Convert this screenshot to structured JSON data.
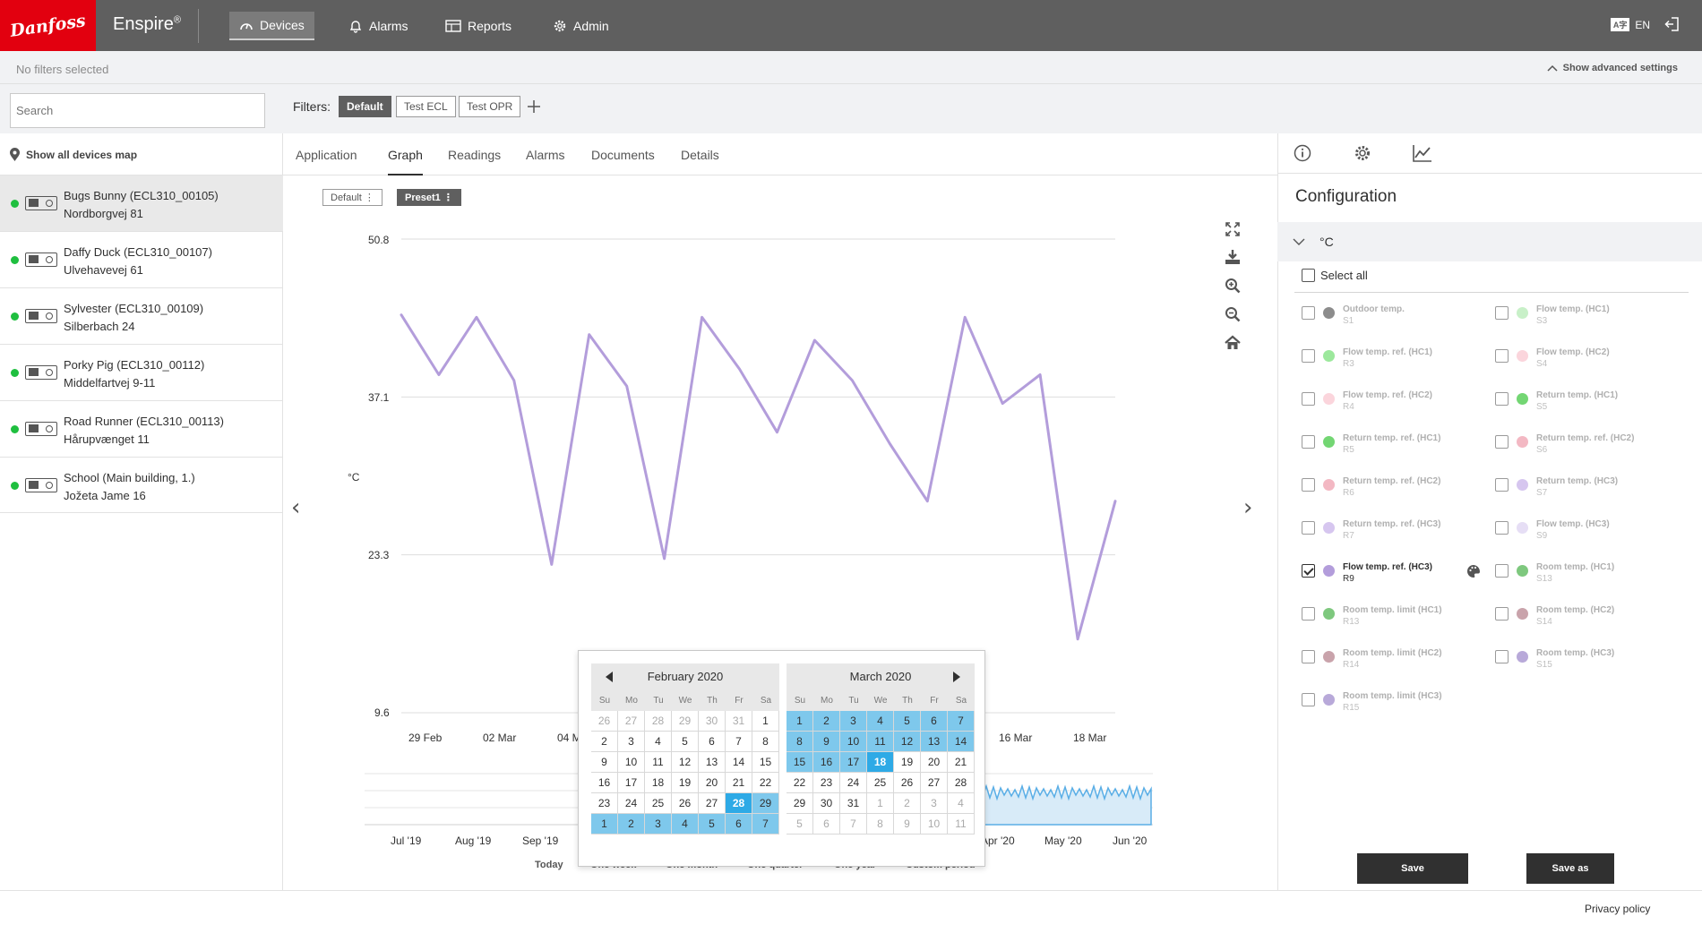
{
  "header": {
    "logo_text": "Danfoss",
    "brand": "Enspire",
    "brand_mark": "®",
    "nav": [
      {
        "label": "Devices",
        "icon": "gauge-icon",
        "active": true
      },
      {
        "label": "Alarms",
        "icon": "bell-icon"
      },
      {
        "label": "Reports",
        "icon": "table-icon"
      },
      {
        "label": "Admin",
        "icon": "gear-icon"
      }
    ],
    "language_badge": "A字",
    "language": "EN",
    "logout_icon": "logout-icon"
  },
  "filterbar": {
    "status": "No filters selected",
    "advanced_link": "Show advanced settings",
    "search_placeholder": "Search",
    "filters_label": "Filters:",
    "chips": [
      "Default",
      "Test ECL",
      "Test OPR"
    ],
    "add_icon": "plus-icon"
  },
  "sidebar": {
    "map_link": "Show all devices map",
    "devices": [
      {
        "name": "Bugs Bunny (ECL310_00105)",
        "address": "Nordborgvej 81",
        "online": true,
        "selected": true
      },
      {
        "name": "Daffy Duck (ECL310_00107)",
        "address": "Ulvehavevej 61",
        "online": true
      },
      {
        "name": "Sylvester (ECL310_00109)",
        "address": "Silberbach 24",
        "online": true
      },
      {
        "name": "Porky Pig (ECL310_00112)",
        "address": "Middelfartvej 9-11",
        "online": true
      },
      {
        "name": "Road Runner (ECL310_00113)",
        "address": "Hårupvænget 11",
        "online": true
      },
      {
        "name": "School (Main building, 1.)",
        "address": "Jožeta Jame 16",
        "online": true
      }
    ]
  },
  "main": {
    "tabs": [
      "Application",
      "Graph",
      "Readings",
      "Alarms",
      "Documents",
      "Details"
    ],
    "active_tab": "Graph",
    "presets": [
      "Default",
      "Preset1"
    ],
    "preset_menu_glyph": "⋮",
    "chart_tools": [
      "fullscreen-icon",
      "download-icon",
      "zoom-in-icon",
      "zoom-out-icon",
      "home-icon"
    ],
    "prev_arrow": "‹",
    "next_arrow": "›",
    "periods": [
      "Today",
      "One week",
      "One month",
      "One quarter",
      "One year",
      "Custom period"
    ]
  },
  "chart_data": {
    "type": "line",
    "title": "",
    "ylabel": "°C",
    "ylim": [
      9.6,
      50.8
    ],
    "yticks": [
      "50.8",
      "37.1",
      "23.3",
      "9.6"
    ],
    "xticks": [
      "29 Feb",
      "02 Mar",
      "04 M",
      "16 Mar",
      "18 Mar"
    ],
    "color": "#b39ddb",
    "x": [
      "2020-02-29",
      "2020-03-01",
      "2020-03-02",
      "2020-03-03",
      "2020-03-04",
      "2020-03-05",
      "2020-03-06",
      "2020-03-07",
      "2020-03-08",
      "2020-03-09",
      "2020-03-10",
      "2020-03-11",
      "2020-03-12",
      "2020-03-13",
      "2020-03-14",
      "2020-03-15",
      "2020-03-16",
      "2020-03-17",
      "2020-03-18",
      "2020-03-19"
    ],
    "series": [
      {
        "values": [
          44.2,
          39.0,
          44.0,
          38.5,
          22.5,
          42.5,
          38.0,
          23.0,
          44.0,
          39.5,
          34.0,
          42.0,
          38.5,
          33.0,
          28.0,
          44.0,
          36.5,
          39.0,
          16.0,
          28.0
        ]
      }
    ],
    "navigator": {
      "x_ticks": [
        "Jul '19",
        "Aug '19",
        "Sep '19",
        "Apr '20",
        "May '20",
        "Jun '20"
      ],
      "color": "#5aaee6"
    }
  },
  "calendar": {
    "weekdays": [
      "Su",
      "Mo",
      "Tu",
      "We",
      "Th",
      "Fr",
      "Sa"
    ],
    "months": [
      {
        "title": "February 2020",
        "days": [
          {
            "d": "26",
            "o": 1
          },
          {
            "d": "27",
            "o": 1
          },
          {
            "d": "28",
            "o": 1
          },
          {
            "d": "29",
            "o": 1
          },
          {
            "d": "30",
            "o": 1
          },
          {
            "d": "31",
            "o": 1
          },
          {
            "d": "1"
          },
          {
            "d": "2"
          },
          {
            "d": "3"
          },
          {
            "d": "4"
          },
          {
            "d": "5"
          },
          {
            "d": "6"
          },
          {
            "d": "7"
          },
          {
            "d": "8"
          },
          {
            "d": "9"
          },
          {
            "d": "10"
          },
          {
            "d": "11"
          },
          {
            "d": "12"
          },
          {
            "d": "13"
          },
          {
            "d": "14"
          },
          {
            "d": "15"
          },
          {
            "d": "16"
          },
          {
            "d": "17"
          },
          {
            "d": "18"
          },
          {
            "d": "19"
          },
          {
            "d": "20"
          },
          {
            "d": "21"
          },
          {
            "d": "22"
          },
          {
            "d": "23"
          },
          {
            "d": "24"
          },
          {
            "d": "25"
          },
          {
            "d": "26"
          },
          {
            "d": "27"
          },
          {
            "d": "28",
            "s": 1
          },
          {
            "d": "29",
            "r": 1
          },
          {
            "d": "1",
            "r": 1
          },
          {
            "d": "2",
            "r": 1
          },
          {
            "d": "3",
            "r": 1
          },
          {
            "d": "4",
            "r": 1
          },
          {
            "d": "5",
            "r": 1
          },
          {
            "d": "6",
            "r": 1
          },
          {
            "d": "7",
            "r": 1
          }
        ]
      },
      {
        "title": "March 2020",
        "days": [
          {
            "d": "1",
            "r": 1
          },
          {
            "d": "2",
            "r": 1
          },
          {
            "d": "3",
            "r": 1
          },
          {
            "d": "4",
            "r": 1
          },
          {
            "d": "5",
            "r": 1
          },
          {
            "d": "6",
            "r": 1
          },
          {
            "d": "7",
            "r": 1
          },
          {
            "d": "8",
            "r": 1
          },
          {
            "d": "9",
            "r": 1
          },
          {
            "d": "10",
            "r": 1
          },
          {
            "d": "11",
            "r": 1
          },
          {
            "d": "12",
            "r": 1
          },
          {
            "d": "13",
            "r": 1
          },
          {
            "d": "14",
            "r": 1
          },
          {
            "d": "15",
            "r": 1
          },
          {
            "d": "16",
            "r": 1
          },
          {
            "d": "17",
            "r": 1
          },
          {
            "d": "18",
            "s": 1
          },
          {
            "d": "19"
          },
          {
            "d": "20"
          },
          {
            "d": "21"
          },
          {
            "d": "22"
          },
          {
            "d": "23"
          },
          {
            "d": "24"
          },
          {
            "d": "25"
          },
          {
            "d": "26"
          },
          {
            "d": "27"
          },
          {
            "d": "28"
          },
          {
            "d": "29"
          },
          {
            "d": "30"
          },
          {
            "d": "31"
          },
          {
            "d": "1",
            "o": 1
          },
          {
            "d": "2",
            "o": 1
          },
          {
            "d": "3",
            "o": 1
          },
          {
            "d": "4",
            "o": 1
          },
          {
            "d": "5",
            "o": 1
          },
          {
            "d": "6",
            "o": 1
          },
          {
            "d": "7",
            "o": 1
          },
          {
            "d": "8",
            "o": 1
          },
          {
            "d": "9",
            "o": 1
          },
          {
            "d": "10",
            "o": 1
          },
          {
            "d": "11",
            "o": 1
          }
        ]
      }
    ]
  },
  "config": {
    "tab_icons": [
      "info-icon",
      "gear-icon",
      "chart-icon"
    ],
    "title": "Configuration",
    "group": "°C",
    "select_all": "Select all",
    "signals": [
      {
        "name": "Outdoor temp.",
        "code": "S1",
        "color": "#8c8c8c"
      },
      {
        "name": "Flow temp. (HC1)",
        "code": "S3",
        "color": "#c8f0c8"
      },
      {
        "name": "Flow temp. ref. (HC1)",
        "code": "R3",
        "color": "#9ce89c"
      },
      {
        "name": "Flow temp. (HC2)",
        "code": "S4",
        "color": "#fbd5dc"
      },
      {
        "name": "Flow temp. ref. (HC2)",
        "code": "R4",
        "color": "#fbd5dc"
      },
      {
        "name": "Return temp. (HC1)",
        "code": "S5",
        "color": "#73d673"
      },
      {
        "name": "Return temp. ref. (HC1)",
        "code": "R5",
        "color": "#73d673"
      },
      {
        "name": "Return temp. ref. (HC2)",
        "code": "S6",
        "color": "#f3b8c3"
      },
      {
        "name": "Return temp. ref. (HC2)",
        "code": "R6",
        "color": "#f3b8c3"
      },
      {
        "name": "Return temp. (HC3)",
        "code": "S7",
        "color": "#d6c6ef"
      },
      {
        "name": "Return temp. ref. (HC3)",
        "code": "R7",
        "color": "#d6c6ef"
      },
      {
        "name": "Flow temp. (HC3)",
        "code": "S9",
        "color": "#e6def5"
      },
      {
        "name": "Flow temp. ref. (HC3)",
        "code": "R9",
        "color": "#b39ddb",
        "checked": true
      },
      {
        "name": "Room temp. (HC1)",
        "code": "S13",
        "color": "#7ec87e"
      },
      {
        "name": "Room temp. limit (HC1)",
        "code": "R13",
        "color": "#7ec87e"
      },
      {
        "name": "Room temp. (HC2)",
        "code": "S14",
        "color": "#c9a3ab"
      },
      {
        "name": "Room temp. limit (HC2)",
        "code": "R14",
        "color": "#c9a3ab"
      },
      {
        "name": "Room temp. (HC3)",
        "code": "S15",
        "color": "#b8a9d9"
      },
      {
        "name": "Room temp. limit (HC3)",
        "code": "R15",
        "color": "#b8a9d9"
      }
    ],
    "save": "Save",
    "save_as": "Save as"
  },
  "footer": {
    "privacy": "Privacy policy"
  }
}
